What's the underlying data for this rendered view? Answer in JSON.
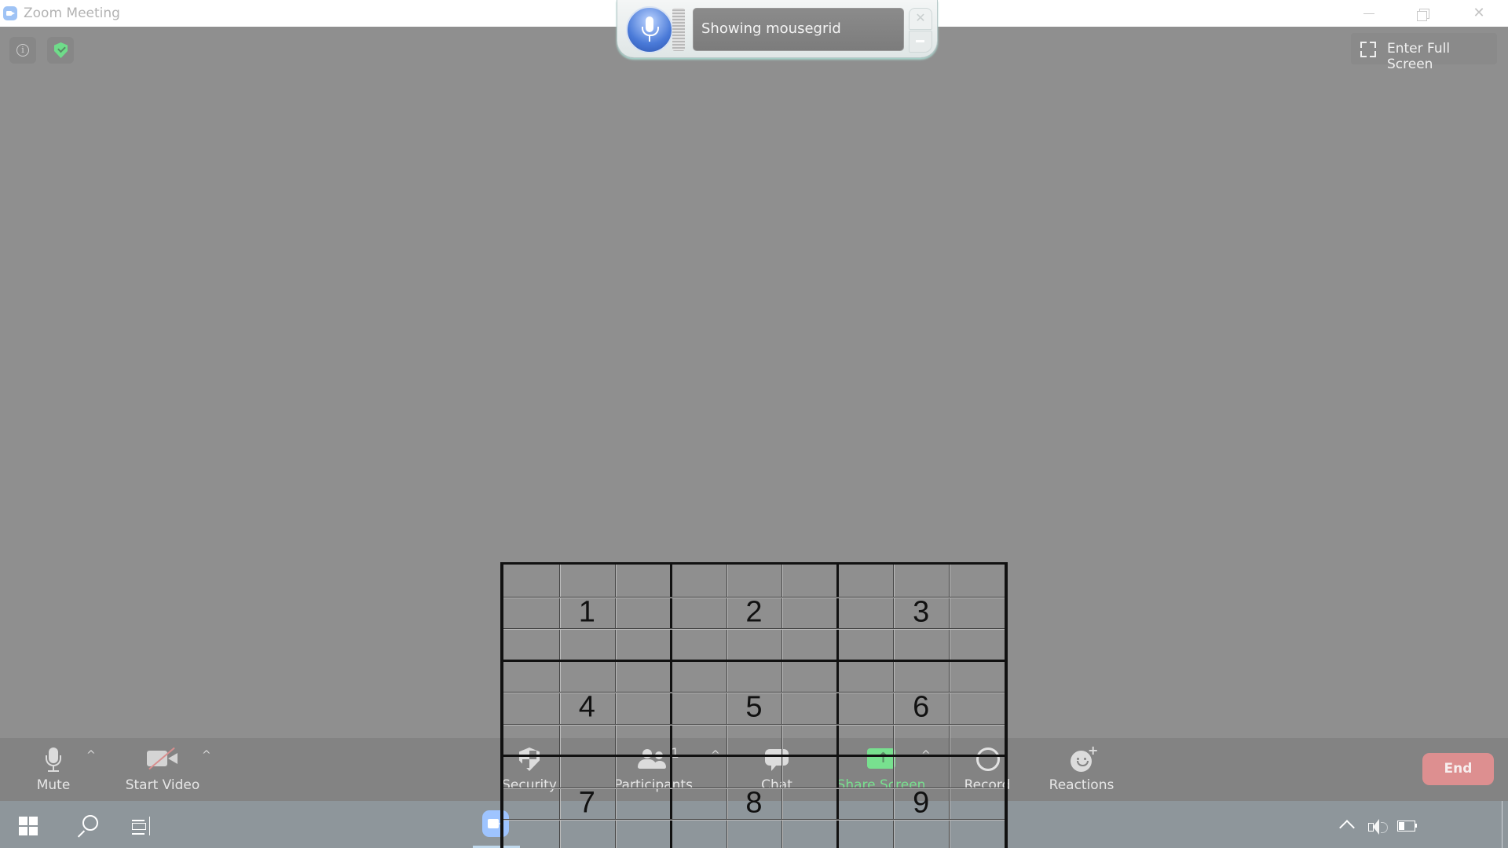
{
  "window": {
    "title": "Zoom Meeting",
    "controls": {
      "minimize": "minimize",
      "maximize": "restore",
      "close": "close"
    }
  },
  "meeting_header": {
    "info_icon": "info-icon",
    "security_icon": "shield-check-icon",
    "fullscreen_label": "Enter Full Screen"
  },
  "speech_recognition": {
    "status_text": "Showing mousegrid",
    "close_glyph": "✕"
  },
  "toolbar": {
    "mute_label": "Mute",
    "start_video_label": "Start Video",
    "security_label": "Security",
    "participants_label": "Participants",
    "participants_count": "1",
    "chat_label": "Chat",
    "share_screen_label": "Share Screen",
    "record_label": "Record",
    "reactions_label": "Reactions",
    "end_label": "End",
    "caret": "^",
    "share_arrow": "↑",
    "reaction_plus": "+",
    "colors": {
      "share": "#78e08f",
      "end": "#dd8f90",
      "video_off_slash": "#d88e8e"
    }
  },
  "mousegrid": {
    "rows": 9,
    "cols": 9,
    "numbers": [
      "1",
      "2",
      "3",
      "4",
      "5",
      "6",
      "7",
      "8",
      "9"
    ]
  },
  "taskbar": {
    "start": "windows-logo",
    "search": "search-icon",
    "task_view": "task-view-icon",
    "pinned": [
      "zoom-app"
    ],
    "tray": [
      "show-hidden-icons",
      "volume-icon",
      "battery-icon"
    ]
  }
}
